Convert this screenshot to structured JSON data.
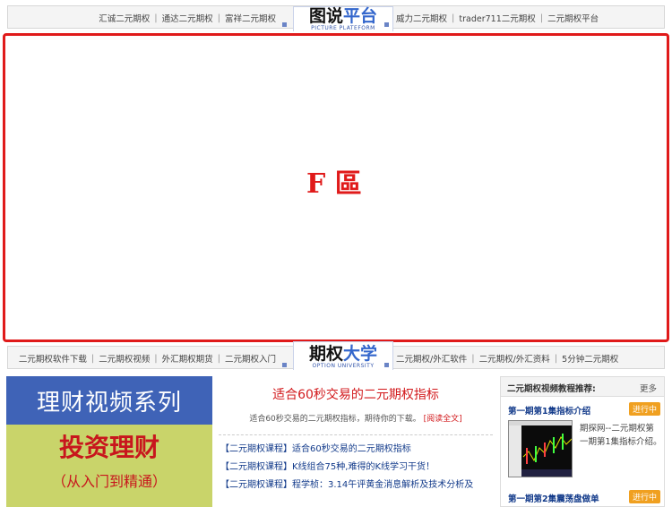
{
  "top_nav": {
    "left_links": [
      "汇诚二元期权",
      "通达二元期权",
      "富祥二元期权"
    ],
    "brand_dark": "图说",
    "brand_blue": "平台",
    "brand_sub": "PICTURE PLATEFORM",
    "right_links": [
      "威力二元期权",
      "trader711二元期权",
      "二元期权平台"
    ]
  },
  "ad_zone": {
    "label": "F 區",
    "border_color": "#e01a1a"
  },
  "mid_nav": {
    "left_links": [
      "二元期权软件下载",
      "二元期权视频",
      "外汇期权期货",
      "二元期权入门"
    ],
    "brand_dark": "期权",
    "brand_blue": "大学",
    "brand_sub": "OPTION UNIVERSITY",
    "right_links": [
      "二元期权/外汇软件",
      "二元期权/外汇资料",
      "5分钟二元期权"
    ]
  },
  "banner": {
    "line1": "理财视频系列",
    "line2": "投资理财",
    "line3": "（从入门到精通）"
  },
  "featured": {
    "headline": "适合60秒交易的二元期权指标",
    "summary": "适合60秒交易的二元期权指标，期待你的下载。",
    "read_more": "[阅读全文]"
  },
  "news_items": [
    "【二元期权课程】适合60秒交易的二元期权指标",
    "【二元期权课程】K线组合75种,难得的K线学习干货！",
    "【二元期权课程】程学桢：3.14午评黄金消息解析及技术分析及"
  ],
  "sidebar": {
    "title": "二元期权视频教程推荐:",
    "more": "更多",
    "episode1": {
      "title": "第一期第1集指标介绍",
      "badge": "进行中",
      "desc": "期探网--二元期权第一期第1集指标介绍。"
    },
    "episode2": {
      "title": "第一期第2集震荡盘做单",
      "badge": "进行中"
    }
  },
  "colors": {
    "accent_red": "#d2191c",
    "brand_blue": "#3366cc",
    "banner_blue": "#3f63b7",
    "banner_green": "#c9d46a"
  }
}
